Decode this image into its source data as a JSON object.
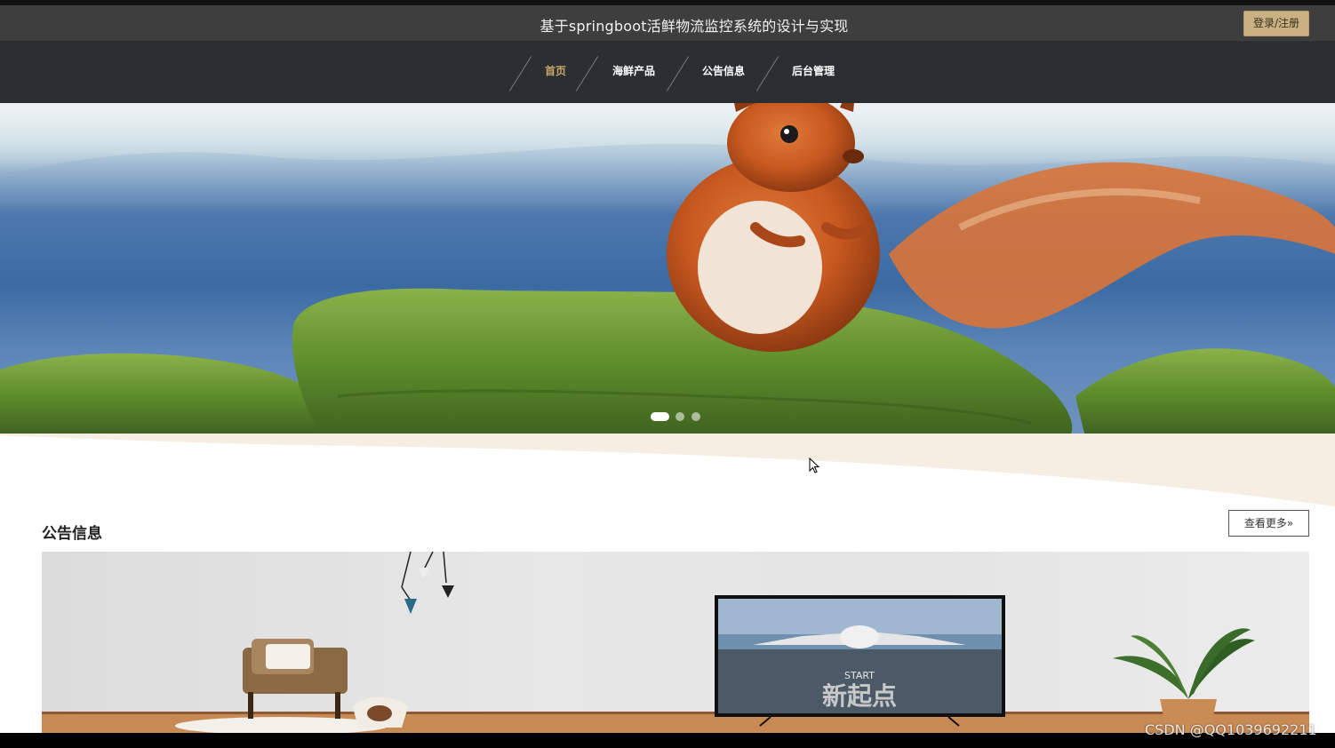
{
  "header": {
    "site_title": "基于springboot活鲜物流监控系统的设计与实现",
    "login_label": "登录/注册"
  },
  "nav": {
    "items": [
      {
        "label": "首页",
        "active": true
      },
      {
        "label": "海鲜产品",
        "active": false
      },
      {
        "label": "公告信息",
        "active": false
      },
      {
        "label": "后台管理",
        "active": false
      }
    ]
  },
  "carousel": {
    "slide_count": 3,
    "active_index": 0,
    "image_subject": "squirrel-on-mossy-rock"
  },
  "notice_section": {
    "title": "公告信息",
    "more_label": "查看更多",
    "more_icon": "double-chevron-right-icon",
    "tv_text_top": "START",
    "tv_text_main": "新起点"
  },
  "watermark": "CSDN @QQ1039692211",
  "colors": {
    "title_bar": "#3e3e3e",
    "nav_bar": "#2c2f31",
    "accent": "#c9a46a",
    "login_button": "#c9b184",
    "wave": "#f6ede3"
  }
}
